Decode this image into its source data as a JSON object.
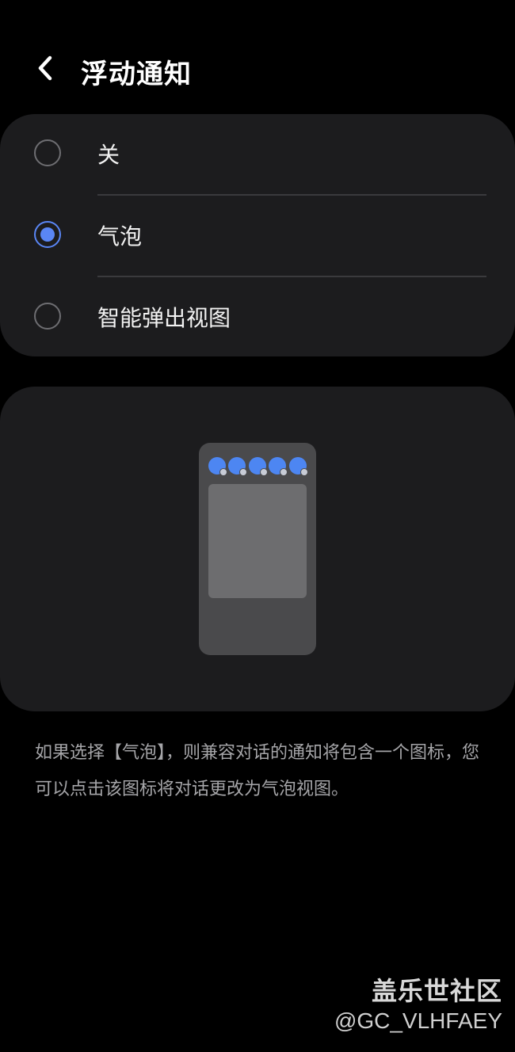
{
  "header": {
    "title": "浮动通知",
    "back_icon": "chevron-left-icon"
  },
  "options": [
    {
      "label": "关",
      "selected": false
    },
    {
      "label": "气泡",
      "selected": true
    },
    {
      "label": "智能弹出视图",
      "selected": false
    }
  ],
  "preview": {
    "bubble_count": 5,
    "bubble_color": "#4d86f2"
  },
  "description": "如果选择【气泡】，则兼容对话的通知将包含一个图标，您可以点击该图标将对话更改为气泡视图。",
  "watermark": {
    "brand": "盖乐世社区",
    "user": "@GC_VLHFAEY"
  },
  "colors": {
    "accent": "#5a86f5",
    "card_background": "#1c1c1e",
    "page_background": "#000000"
  }
}
